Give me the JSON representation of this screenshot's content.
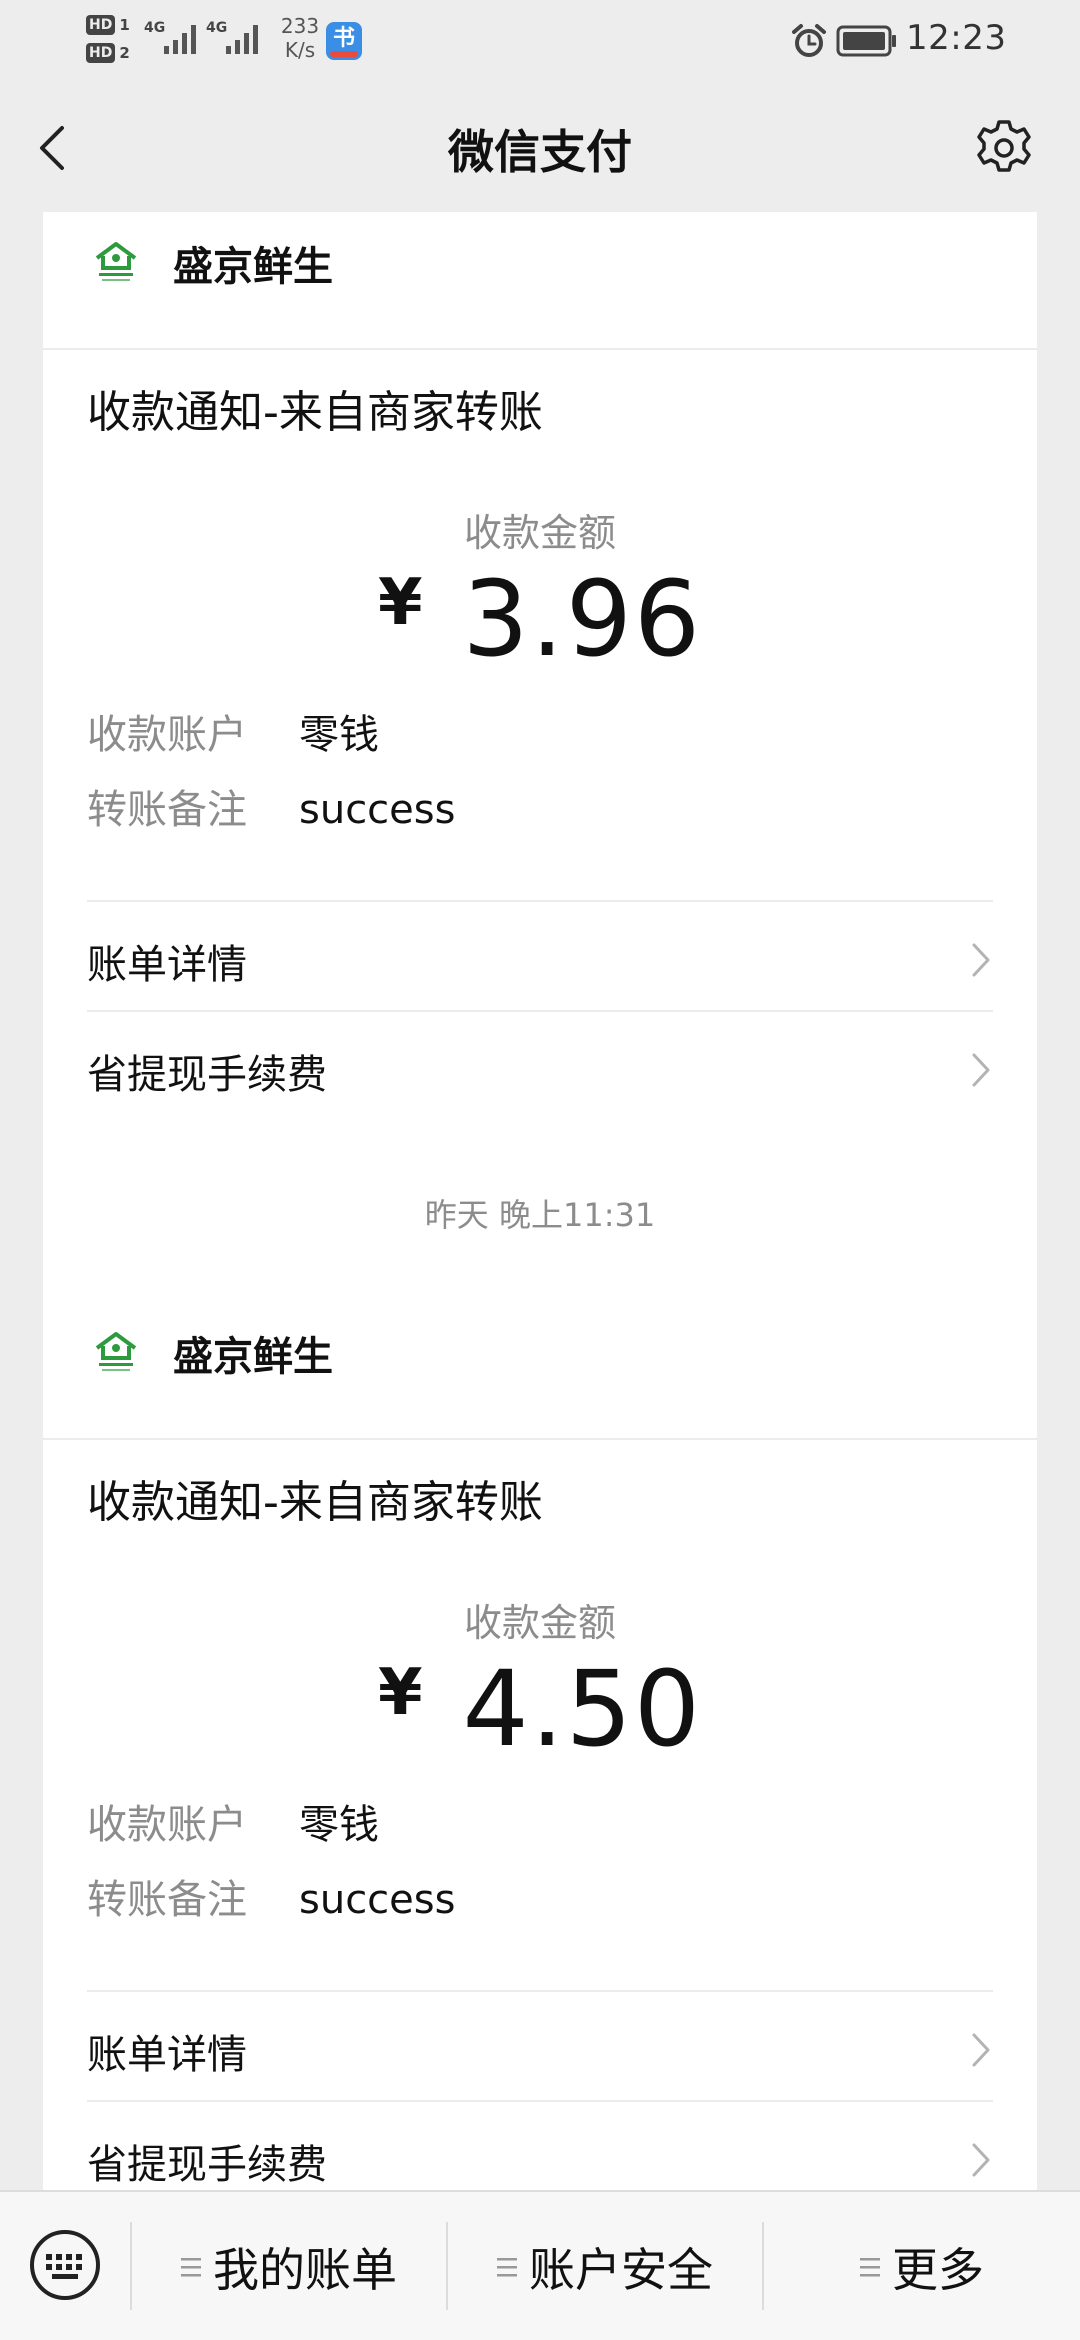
{
  "status_bar": {
    "hd1": "HD",
    "hd1_index": "1",
    "hd2": "HD",
    "hd2_index": "2",
    "sim1_network": "4G",
    "sim2_network": "4G",
    "net_speed_value": "233",
    "net_speed_unit": "K/s",
    "app_badge_glyph": "书",
    "time": "12:23",
    "icons": [
      "alarm-icon",
      "battery-icon"
    ]
  },
  "nav": {
    "title": "微信支付",
    "back_icon": "chevron-left-icon",
    "settings_icon": "gear-icon"
  },
  "messages": [
    {
      "merchant": "盛京鲜生",
      "title": "收款通知-来自商家转账",
      "amount_label": "收款金额",
      "currency": "¥",
      "amount": "3.96",
      "account_label": "收款账户",
      "account_value": "零钱",
      "remark_label": "转账备注",
      "remark_value": "success",
      "actions": [
        "账单详情",
        "省提现手续费"
      ]
    },
    {
      "merchant": "盛京鲜生",
      "title": "收款通知-来自商家转账",
      "amount_label": "收款金额",
      "currency": "¥",
      "amount": "4.50",
      "account_label": "收款账户",
      "account_value": "零钱",
      "remark_label": "转账备注",
      "remark_value": "success",
      "actions": [
        "账单详情",
        "省提现手续费"
      ]
    }
  ],
  "timestamp": "昨天 晚上11:31",
  "bottom_bar": {
    "keyboard_icon": "keyboard-icon",
    "tabs": [
      "我的账单",
      "账户安全",
      "更多"
    ]
  },
  "colors": {
    "background": "#ededed",
    "card": "#ffffff",
    "secondary_text": "#8c8c8c",
    "primary_text": "#111111",
    "logo_green": "#2e9a3e"
  }
}
